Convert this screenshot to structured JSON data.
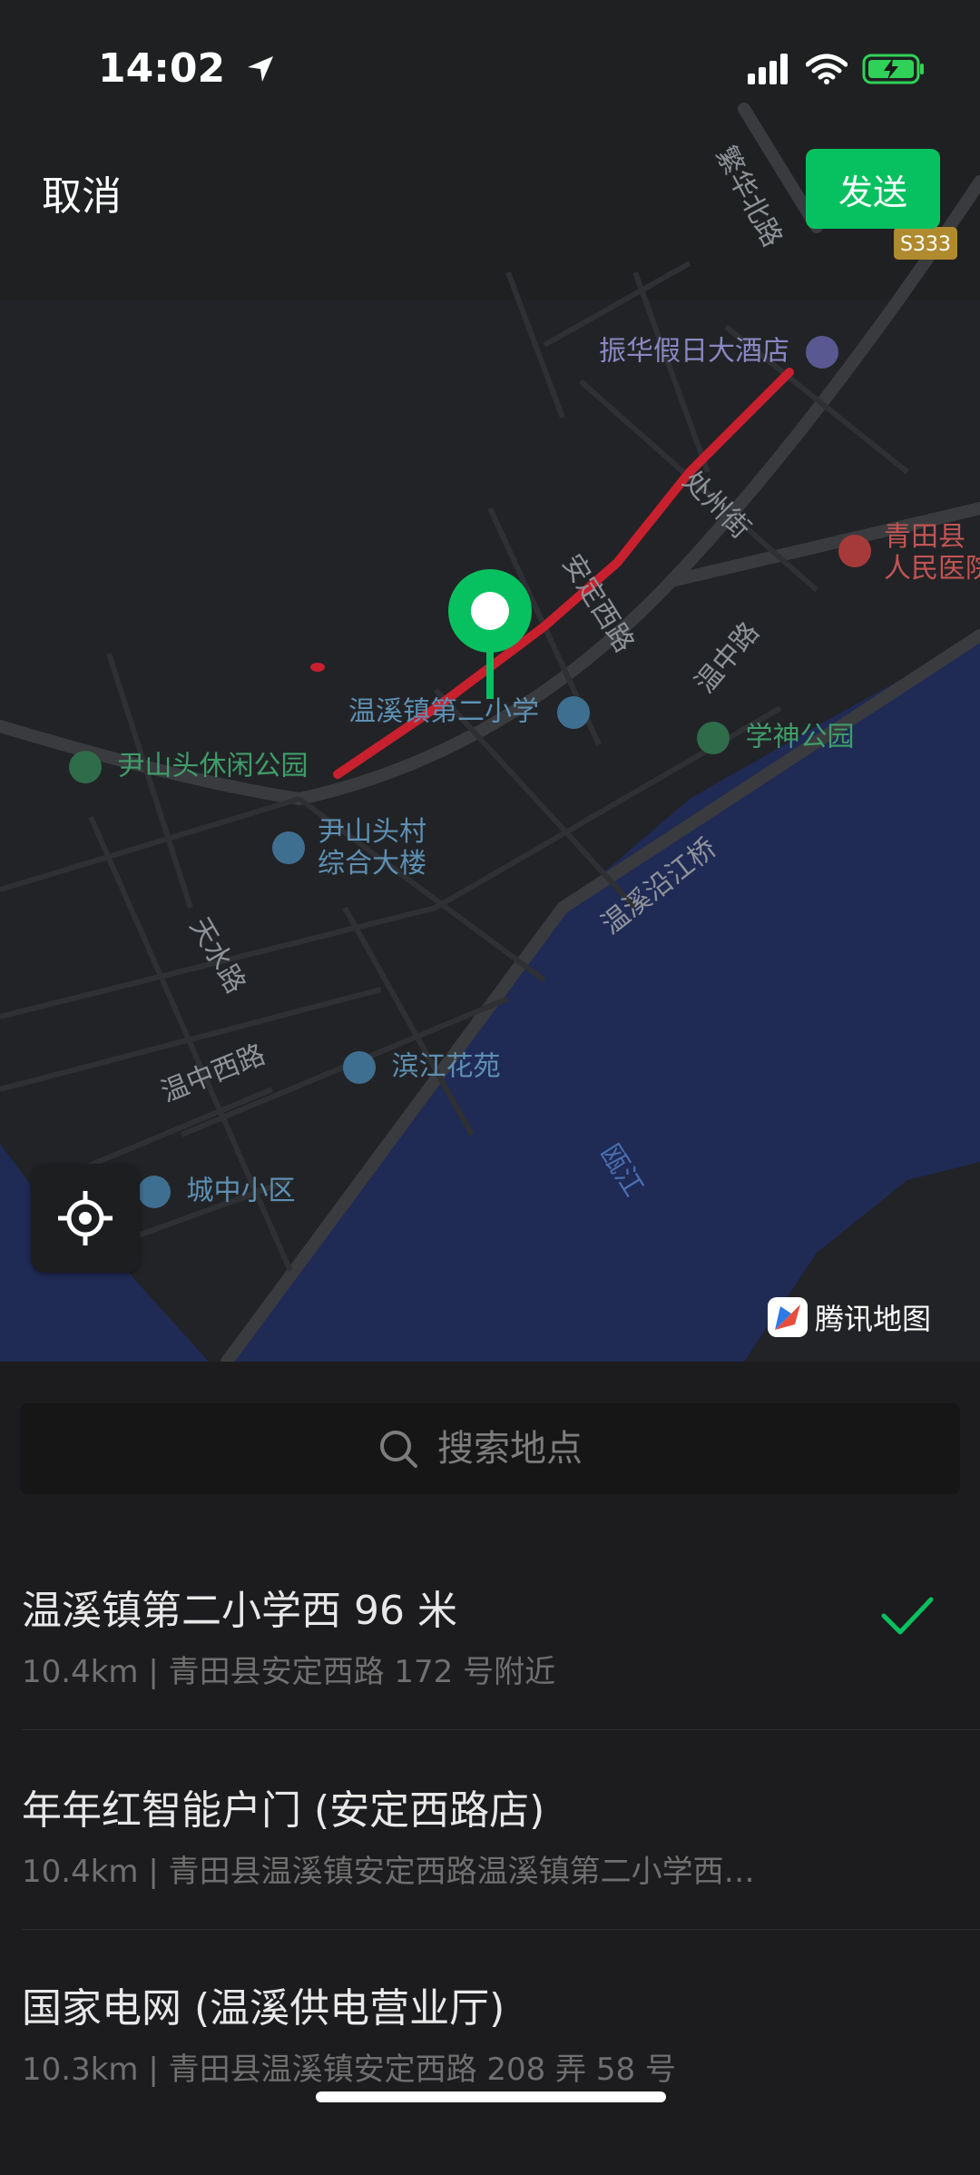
{
  "status_bar": {
    "time": "14:02",
    "icons": [
      "location-arrow-icon",
      "signal-icon",
      "wifi-icon",
      "battery-charging-icon"
    ],
    "battery_color": "#30d158"
  },
  "header": {
    "cancel_label": "取消",
    "send_label": "发送"
  },
  "map": {
    "provider_label": "腾讯地图",
    "route_color": "#c8202e",
    "pin_color": "#07c160",
    "road_badge": "S333",
    "pois": [
      {
        "id": "hotel",
        "label": "振华假日大酒店",
        "icon": "hotel-icon"
      },
      {
        "id": "hospital",
        "label": "青田县人民医院",
        "line1": "青田县",
        "line2": "人民医院",
        "icon": "hospital-icon"
      },
      {
        "id": "school",
        "label": "温溪镇第二小学",
        "icon": "school-icon"
      },
      {
        "id": "park1",
        "label": "尹山头休闲公园",
        "icon": "park-icon"
      },
      {
        "id": "park2",
        "label": "学神公园",
        "icon": "park-icon"
      },
      {
        "id": "building",
        "line1": "尹山头村",
        "line2": "综合大楼",
        "icon": "building-icon"
      },
      {
        "id": "binjiang",
        "label": "滨江花苑",
        "icon": "residential-icon"
      },
      {
        "id": "chengzhong",
        "label": "城中小区",
        "icon": "residential-icon"
      }
    ],
    "roads": {
      "fanhua": "繁华北路",
      "chuzhou": "处州街",
      "anding": "安定西路",
      "wenzhong": "温中路",
      "tianshui": "天水路",
      "wenzhongxi": "温中西路",
      "yanjiang": "温溪沿江桥",
      "river": "瓯江"
    }
  },
  "search": {
    "placeholder": "搜索地点"
  },
  "places": [
    {
      "name": "温溪镇第二小学西 96 米",
      "detail": "10.4km | 青田县安定西路 172 号附近",
      "selected": true
    },
    {
      "name": "年年红智能户门 (安定西路店)",
      "detail": "10.4km | 青田县温溪镇安定西路温溪镇第二小学西…",
      "selected": false
    },
    {
      "name": "国家电网 (温溪供电营业厅)",
      "detail": "10.3km | 青田县温溪镇安定西路 208 弄 58 号",
      "selected": false
    }
  ]
}
